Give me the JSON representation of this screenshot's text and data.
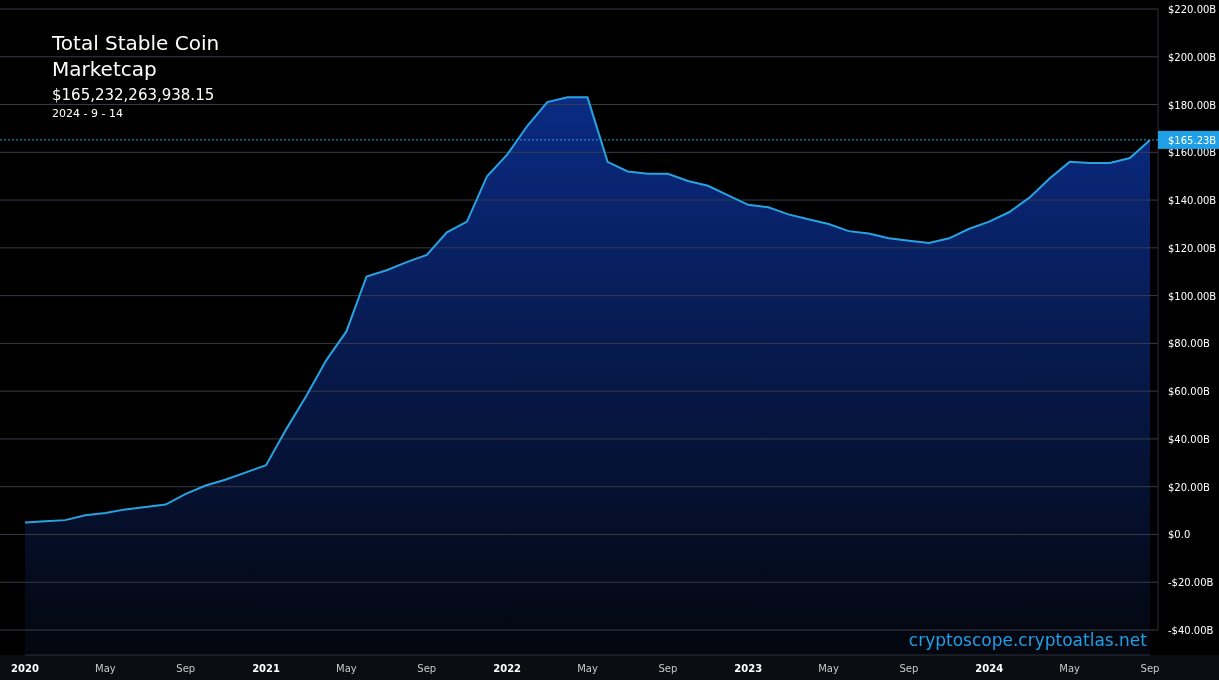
{
  "header": {
    "value": "$165,232,263,938.15",
    "date": "2024 - 9 - 14"
  },
  "chart": {
    "brand": "cryptoscope.cryptoatlas.net",
    "chart_data": {
      "type": "area",
      "grid": true,
      "xlim": [
        "2020-01",
        "2024-09"
      ],
      "ref_lines": [
        {
          "axis": "y",
          "value": 165.2,
          "label": "$165.23B"
        }
      ],
      "x": [
        "2020-01",
        "2020-02",
        "2020-03",
        "2020-04",
        "2020-05",
        "2020-06",
        "2020-07",
        "2020-08",
        "2020-09",
        "2020-10",
        "2020-11",
        "2020-12",
        "2021-01",
        "2021-02",
        "2021-03",
        "2021-04",
        "2021-05",
        "2021-06",
        "2021-07",
        "2021-08",
        "2021-09",
        "2021-10",
        "2021-11",
        "2021-12",
        "2022-01",
        "2022-02",
        "2022-03",
        "2022-04",
        "2022-05",
        "2022-06",
        "2022-07",
        "2022-08",
        "2022-09",
        "2022-10",
        "2022-11",
        "2022-12",
        "2023-01",
        "2023-02",
        "2023-03",
        "2023-04",
        "2023-05",
        "2023-06",
        "2023-07",
        "2023-08",
        "2023-09",
        "2023-10",
        "2023-11",
        "2023-12",
        "2024-01",
        "2024-02",
        "2024-03",
        "2024-04",
        "2024-05",
        "2024-06",
        "2024-07",
        "2024-08",
        "2024-09"
      ],
      "series": [
        {
          "name": "Total Stable Coin Marketcap",
          "color": "#29a3e0",
          "values": [
            5,
            5.5,
            6,
            8,
            9,
            10.5,
            11.5,
            12.5,
            17,
            20.5,
            23,
            26,
            29,
            44,
            58,
            73,
            85,
            108,
            110.6,
            114,
            117,
            126.5,
            131,
            150,
            159,
            171,
            181,
            183,
            183,
            156,
            152,
            151,
            151,
            148,
            146,
            142,
            138,
            137,
            134,
            132,
            130,
            127,
            126,
            124,
            123,
            122,
            124,
            128,
            131,
            135,
            141,
            149,
            156,
            155.5,
            155.5,
            157.6,
            165.2
          ]
        }
      ],
      "ylim": [
        -40,
        220
      ],
      "yticks": [
        {
          "value": -40,
          "label": "-$40.00B"
        },
        {
          "value": -20,
          "label": "-$20.00B"
        },
        {
          "value": 0,
          "label": "$0.0"
        },
        {
          "value": 20,
          "label": "$20.00B"
        },
        {
          "value": 40,
          "label": "$40.00B"
        },
        {
          "value": 60,
          "label": "$60.00B"
        },
        {
          "value": 80,
          "label": "$80.00B"
        },
        {
          "value": 100,
          "label": "$100.00B"
        },
        {
          "value": 120,
          "label": "$120.00B"
        },
        {
          "value": 140,
          "label": "$140.00B"
        },
        {
          "value": 160,
          "label": "$160.00B"
        },
        {
          "value": 180,
          "label": "$180.00B"
        },
        {
          "value": 200,
          "label": "$200.00B"
        },
        {
          "value": 220,
          "label": "$220.00B"
        }
      ],
      "xticks": [
        {
          "value": "2020-01",
          "label": "2020"
        },
        {
          "value": "2020-05",
          "label": "May"
        },
        {
          "value": "2020-09",
          "label": "Sep"
        },
        {
          "value": "2021-01",
          "label": "2021"
        },
        {
          "value": "2021-05",
          "label": "May"
        },
        {
          "value": "2021-09",
          "label": "Sep"
        },
        {
          "value": "2022-01",
          "label": "2022"
        },
        {
          "value": "2022-05",
          "label": "May"
        },
        {
          "value": "2022-09",
          "label": "Sep"
        },
        {
          "value": "2023-01",
          "label": "2023"
        },
        {
          "value": "2023-05",
          "label": "May"
        },
        {
          "value": "2023-09",
          "label": "Sep"
        },
        {
          "value": "2024-01",
          "label": "2024"
        },
        {
          "value": "2024-05",
          "label": "May"
        },
        {
          "value": "2024-09",
          "label": "Sep"
        }
      ]
    }
  }
}
